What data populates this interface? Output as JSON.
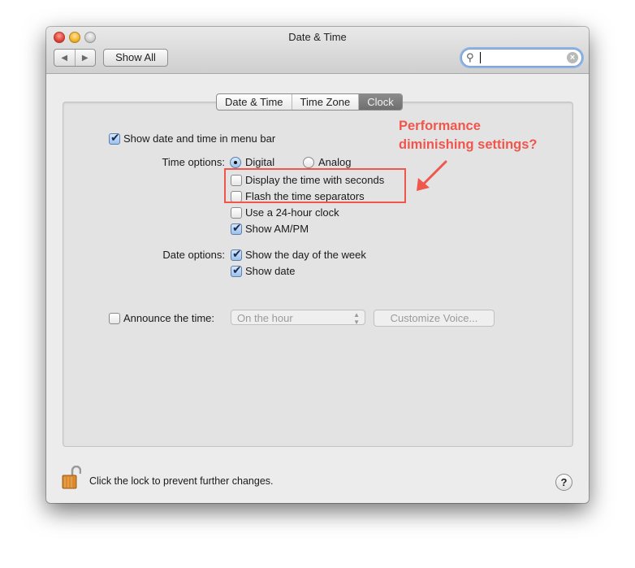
{
  "window": {
    "title": "Date & Time",
    "show_all_label": "Show All",
    "nav_back_icon": "back-arrow-icon",
    "nav_forward_icon": "forward-arrow-icon",
    "search": {
      "value": "",
      "placeholder": ""
    }
  },
  "tabs": [
    {
      "label": "Date & Time",
      "active": false
    },
    {
      "label": "Time Zone",
      "active": false
    },
    {
      "label": "Clock",
      "active": true
    }
  ],
  "clock": {
    "show_in_menu_bar": {
      "label": "Show date and time in menu bar",
      "checked": true
    },
    "time_options_label": "Time options:",
    "time_style": [
      {
        "label": "Digital",
        "selected": true
      },
      {
        "label": "Analog",
        "selected": false
      }
    ],
    "time_checkboxes": [
      {
        "label": "Display the time with seconds",
        "checked": false
      },
      {
        "label": "Flash the time separators",
        "checked": false
      },
      {
        "label": "Use a 24-hour clock",
        "checked": false
      },
      {
        "label": "Show AM/PM",
        "checked": true
      }
    ],
    "date_options_label": "Date options:",
    "date_checkboxes": [
      {
        "label": "Show the day of the week",
        "checked": true
      },
      {
        "label": "Show date",
        "checked": true
      }
    ],
    "announce": {
      "label": "Announce the time:",
      "checked": false,
      "interval_value": "On the hour",
      "customize_voice_label": "Customize Voice..."
    }
  },
  "annotation": {
    "line1": "Performance",
    "line2": "diminishing settings?",
    "color": "#f0564c"
  },
  "footer": {
    "lock_text": "Click the lock to prevent further changes.",
    "help_label": "?"
  }
}
